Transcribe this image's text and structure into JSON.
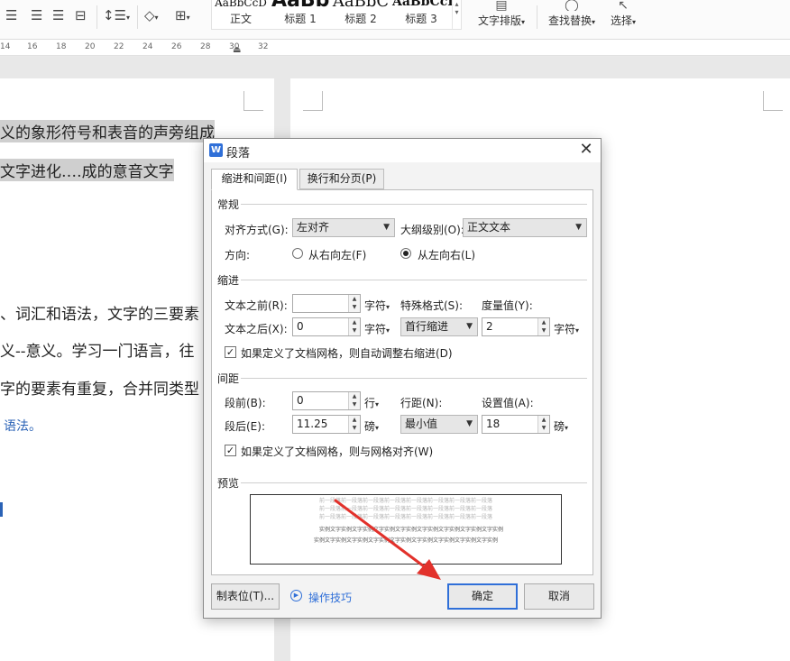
{
  "ribbon": {
    "styles": [
      {
        "name": "正文",
        "preview": "AaBbCcD"
      },
      {
        "name": "标题 1",
        "preview": "AaBb"
      },
      {
        "name": "标题 2",
        "preview": "AaBbC"
      },
      {
        "name": "标题 3",
        "preview": "AaBbCcI"
      }
    ],
    "text_layout": "文字排版",
    "find_replace": "查找替换",
    "select": "选择"
  },
  "ruler": {
    "ticks": [
      "14",
      "16",
      "18",
      "20",
      "22",
      "24",
      "26",
      "28",
      "30",
      "32"
    ]
  },
  "document": {
    "lines": [
      "义的象形符号和表音的声旁组成",
      "文字进化‥‥成的意音文字",
      "、词汇和语法，文字的三要素",
      "义--意义。学习一门语言，往",
      "字的要素有重复，合并同类型",
      "语法。"
    ]
  },
  "dialog": {
    "title": "段落",
    "logo": "W",
    "tabs": {
      "indent_spacing": "缩进和间距(I)",
      "line_page": "换行和分页(P)"
    },
    "general": {
      "section": "常规",
      "align_label": "对齐方式(G):",
      "align_value": "左对齐",
      "outline_label": "大纲级别(O):",
      "outline_value": "正文文本",
      "direction_label": "方向:",
      "rtl": "从右向左(F)",
      "ltr": "从左向右(L)"
    },
    "indent": {
      "section": "缩进",
      "before_label": "文本之前(R):",
      "before_value": "",
      "after_label": "文本之后(X):",
      "after_value": "0",
      "unit": "字符",
      "special_label": "特殊格式(S):",
      "special_value": "首行缩进",
      "measure_label": "度量值(Y):",
      "measure_value": "2",
      "measure_unit": "字符",
      "auto_adjust": "如果定义了文档网格，则自动调整右缩进(D)"
    },
    "spacing": {
      "section": "间距",
      "before_label": "段前(B):",
      "before_value": "0",
      "before_unit": "行",
      "after_label": "段后(E):",
      "after_value": "11.25",
      "after_unit": "磅",
      "line_label": "行距(N):",
      "line_value": "最小值",
      "setting_label": "设置值(A):",
      "setting_value": "18",
      "setting_unit": "磅",
      "snap_grid": "如果定义了文档网格，则与网格对齐(W)"
    },
    "preview": {
      "section": "预览",
      "grey_text": "前一段落前一段落前一段落前一段落前一段落前一段落前一段落前一段落",
      "sample_text": "实例文字实例文字实例文字实例文字实例文字实例文字实例文字实例文字实例"
    },
    "buttons": {
      "tabs": "制表位(T)...",
      "tips": "操作技巧",
      "ok": "确定",
      "cancel": "取消"
    }
  },
  "colors": {
    "accent": "#2f6fd8",
    "arrow": "#e2312b",
    "highlight": "#cfcfcf"
  }
}
